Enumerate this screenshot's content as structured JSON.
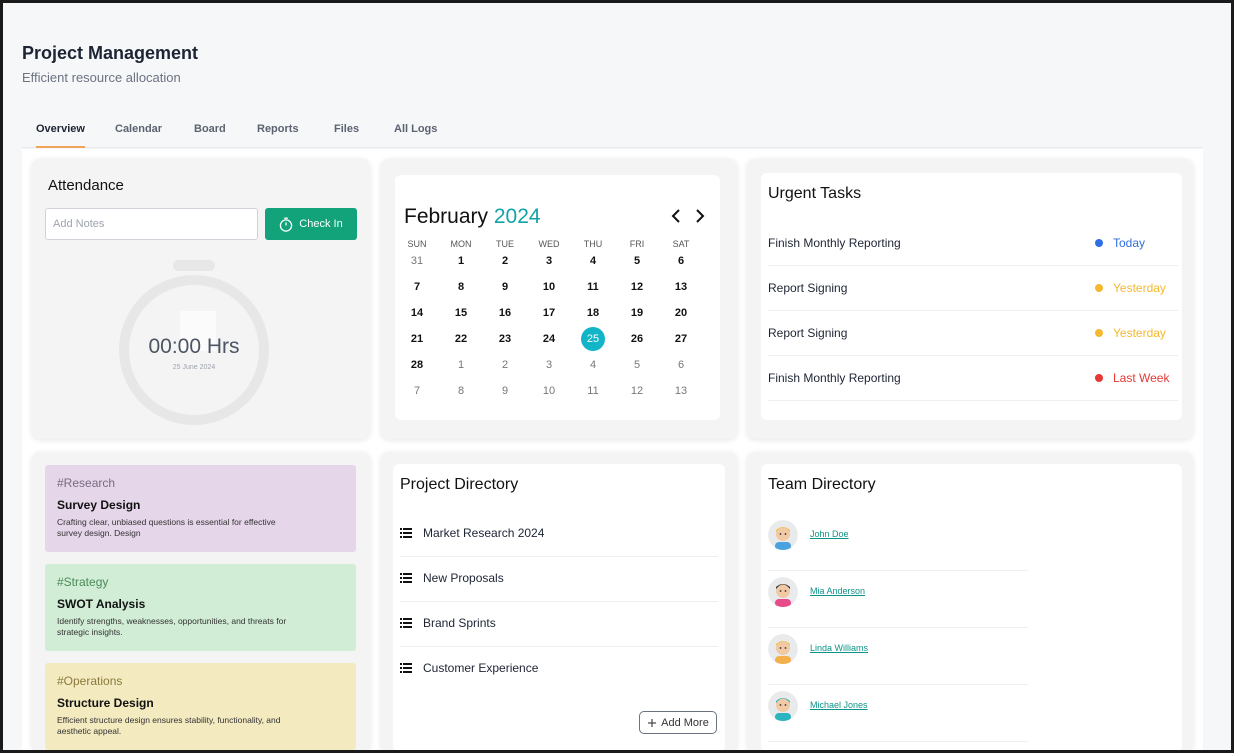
{
  "header": {
    "title": "Project Management",
    "subtitle": "Efficient resource allocation"
  },
  "tabs": [
    "Overview",
    "Calendar",
    "Board",
    "Reports",
    "Files",
    "All Logs"
  ],
  "active_tab": "Overview",
  "attendance": {
    "title": "Attendance",
    "notes_placeholder": "Add Notes",
    "checkin_label": "Check In",
    "timer": "00:00 Hrs",
    "date": "25 June 2024"
  },
  "calendar": {
    "month": "February",
    "year": "2024",
    "weekdays": [
      "SUN",
      "MON",
      "TUE",
      "WED",
      "THU",
      "FRI",
      "SAT"
    ],
    "weeks": [
      [
        "31",
        "1",
        "2",
        "3",
        "4",
        "5",
        "6"
      ],
      [
        "7",
        "8",
        "9",
        "10",
        "11",
        "12",
        "13"
      ],
      [
        "14",
        "15",
        "16",
        "17",
        "18",
        "19",
        "20"
      ],
      [
        "21",
        "22",
        "23",
        "24",
        "25",
        "26",
        "27"
      ],
      [
        "28",
        "1",
        "2",
        "3",
        "4",
        "5",
        "6"
      ],
      [
        "7",
        "8",
        "9",
        "10",
        "11",
        "12",
        "13"
      ]
    ],
    "selected": "25",
    "selected_color": "#12b5c8"
  },
  "urgent_tasks": {
    "title": "Urgent Tasks",
    "items": [
      {
        "name": "Finish Monthly Reporting",
        "due": "Today",
        "color": "#2f6fe4"
      },
      {
        "name": "Report Signing",
        "due": "Yesterday",
        "color": "#f5b82e"
      },
      {
        "name": "Report Signing",
        "due": "Yesterday",
        "color": "#f5b82e"
      },
      {
        "name": "Finish Monthly Reporting",
        "due": "Last Week",
        "color": "#e53935"
      }
    ]
  },
  "notes": [
    {
      "tag": "#Research",
      "title": "Survey Design",
      "desc": "Crafting clear, unbiased questions is essential for effective survey design. Design",
      "bg": "#e6d6ea",
      "tag_color": "#7b6a80"
    },
    {
      "tag": "#Strategy",
      "title": "SWOT Analysis",
      "desc": "Identify strengths, weaknesses, opportunities, and threats for strategic insights.",
      "bg": "#d1edd6",
      "tag_color": "#4a8a57"
    },
    {
      "tag": "#Operations",
      "title": "Structure Design",
      "desc": "Efficient structure design ensures stability, functionality, and aesthetic appeal.",
      "bg": "#f3eac0",
      "tag_color": "#8a7a3a"
    }
  ],
  "project_directory": {
    "title": "Project Directory",
    "items": [
      "Market Research 2024",
      "New Proposals",
      "Brand Sprints",
      "Customer Experience"
    ],
    "add_more_label": "Add More"
  },
  "team_directory": {
    "title": "Team Directory",
    "members": [
      {
        "name": "John Doe",
        "skin": "#f1c9a5",
        "hair": "#f0c24a",
        "shirt": "#4aa3df"
      },
      {
        "name": "Mia Anderson",
        "skin": "#f1c9a5",
        "hair": "#2b2b2b",
        "shirt": "#e84a8a"
      },
      {
        "name": "Linda Williams",
        "skin": "#f1c9a5",
        "hair": "#f0c24a",
        "shirt": "#f3b04b"
      },
      {
        "name": "Michael Jones",
        "skin": "#f1c9a5",
        "hair": "#2bb5c0",
        "shirt": "#2bb5c0"
      }
    ]
  },
  "accent_color": "#12a37a"
}
